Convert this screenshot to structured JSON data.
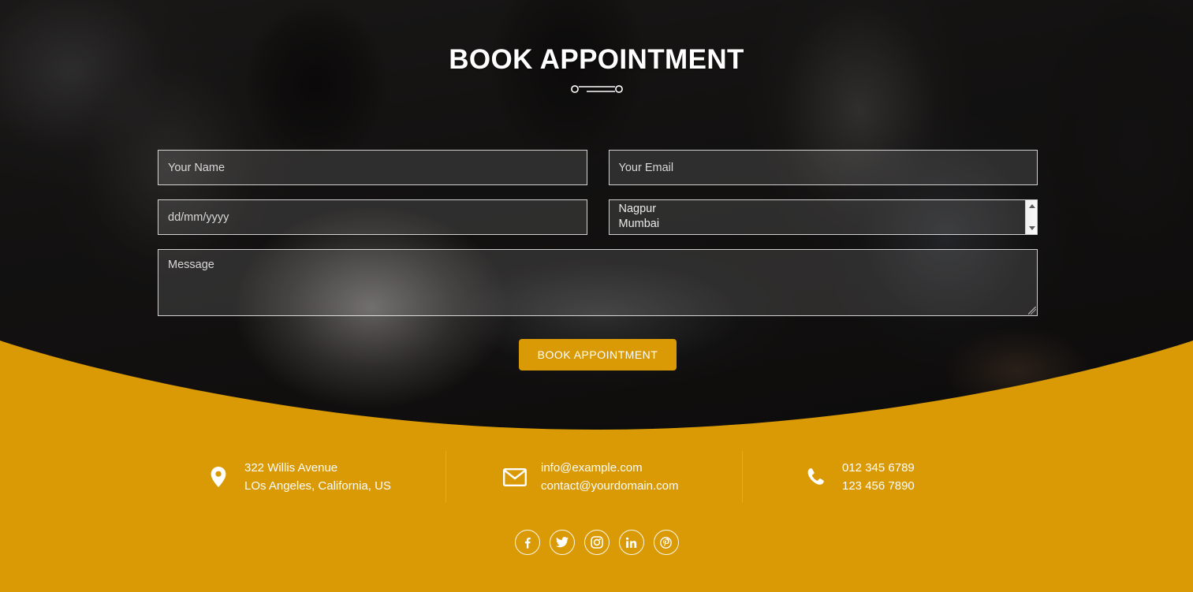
{
  "hero": {
    "title": "BOOK APPOINTMENT",
    "ornament": "double-line-divider"
  },
  "form": {
    "name_field": {
      "placeholder": "Your Name",
      "value": ""
    },
    "email_field": {
      "placeholder": "Your Email",
      "value": ""
    },
    "date_field": {
      "placeholder": "dd/mm/yyyy",
      "value": "dd/mm/yyyy"
    },
    "city_select": {
      "options": [
        "Nagpur",
        "Mumbai"
      ],
      "scrollbar": "vertical-scrollbar"
    },
    "message_field": {
      "placeholder": "Message",
      "value": ""
    },
    "submit_label": "BOOK APPOINTMENT"
  },
  "footer": {
    "contacts": [
      {
        "icon": "map-pin-icon",
        "line1": "322 Willis Avenue",
        "line2": "LOs Angeles, California, US"
      },
      {
        "icon": "envelope-icon",
        "line1": "info@example.com",
        "line2": "contact@yourdomain.com"
      },
      {
        "icon": "phone-icon",
        "line1": "012 345 6789",
        "line2": "123 456 7890"
      }
    ],
    "social": [
      {
        "icon": "facebook-icon",
        "label": "Facebook"
      },
      {
        "icon": "twitter-icon",
        "label": "Twitter"
      },
      {
        "icon": "instagram-icon",
        "label": "Instagram"
      },
      {
        "icon": "linkedin-icon",
        "label": "LinkedIn"
      },
      {
        "icon": "pinterest-icon",
        "label": "Pinterest"
      }
    ]
  },
  "colors": {
    "gold": "#d99a05",
    "button": "#d99a05",
    "hero_overlay": "#0c0b0a",
    "text_light": "#ffffff"
  }
}
